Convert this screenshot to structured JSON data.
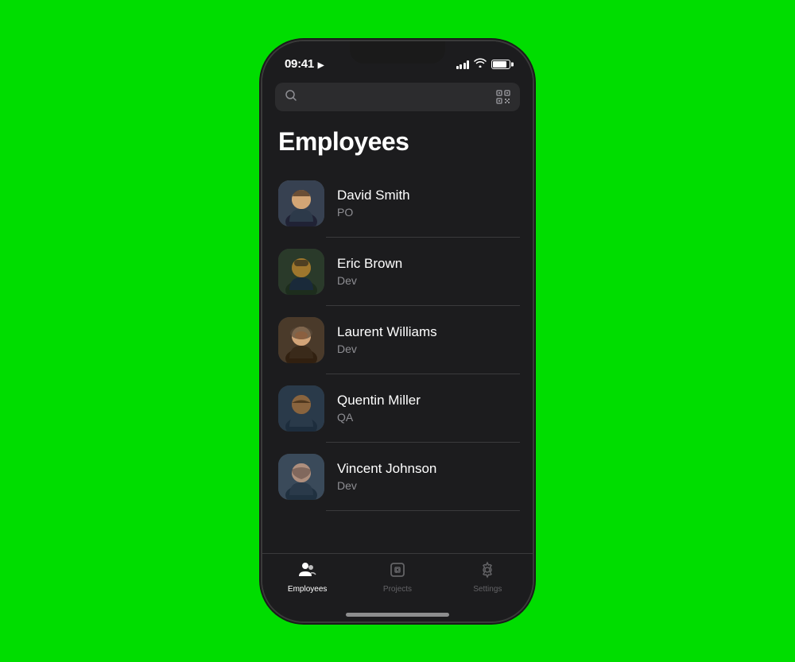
{
  "statusBar": {
    "time": "09:41",
    "locationIcon": "▶"
  },
  "search": {
    "placeholder": ""
  },
  "header": {
    "title": "Employees"
  },
  "employees": [
    {
      "id": "david-smith",
      "name": "David Smith",
      "role": "PO",
      "avatarKey": "david"
    },
    {
      "id": "eric-brown",
      "name": "Eric Brown",
      "role": "Dev",
      "avatarKey": "eric"
    },
    {
      "id": "laurent-williams",
      "name": "Laurent Williams",
      "role": "Dev",
      "avatarKey": "laurent"
    },
    {
      "id": "quentin-miller",
      "name": "Quentin Miller",
      "role": "QA",
      "avatarKey": "quentin"
    },
    {
      "id": "vincent-johnson",
      "name": "Vincent Johnson",
      "role": "Dev",
      "avatarKey": "vincent"
    }
  ],
  "tabs": [
    {
      "id": "employees",
      "label": "Employees",
      "icon": "employees",
      "active": true
    },
    {
      "id": "projects",
      "label": "Projects",
      "icon": "projects",
      "active": false
    },
    {
      "id": "settings",
      "label": "Settings",
      "icon": "settings",
      "active": false
    }
  ],
  "colors": {
    "background": "#1c1c1e",
    "accent": "#ffffff",
    "inactive": "#636366",
    "separator": "#3a3a3c",
    "subtext": "#8e8e93"
  }
}
